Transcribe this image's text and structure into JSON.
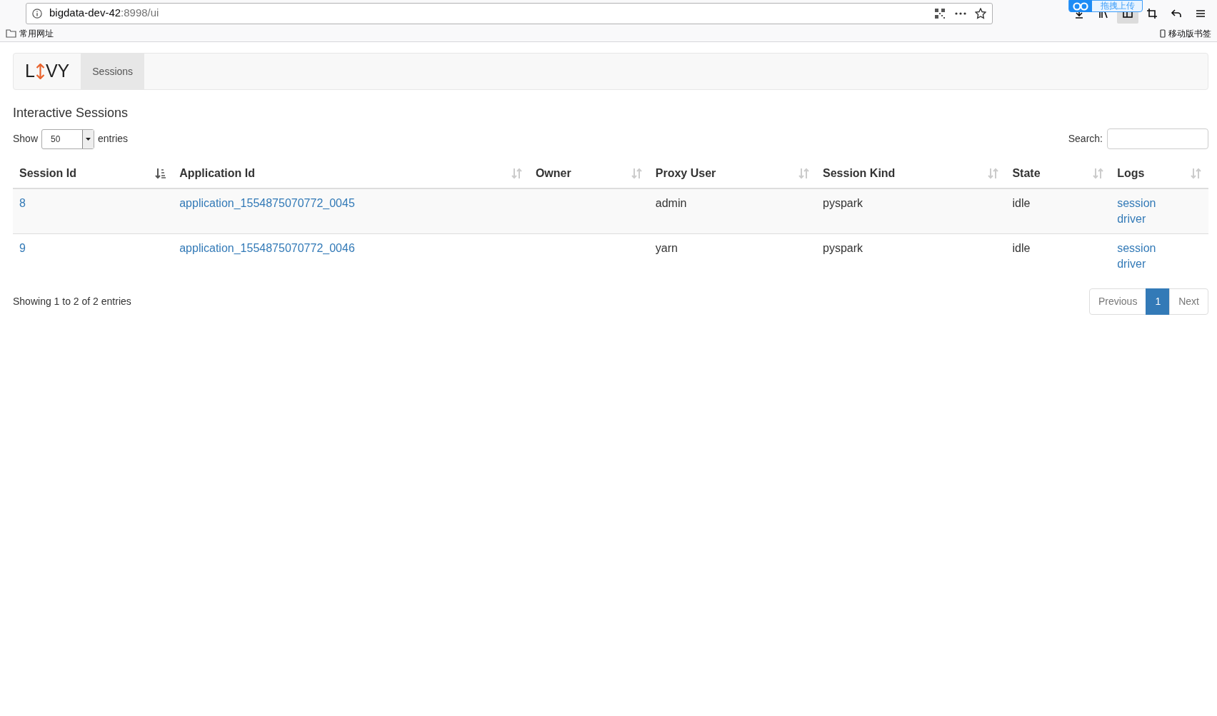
{
  "browser": {
    "url": {
      "host": "bigdata-dev-42",
      "path": ":8998/ui"
    },
    "upload_button": "拖拽上传",
    "toolbar": [
      {
        "kind": "download",
        "selected": false
      },
      {
        "kind": "library",
        "selected": false
      },
      {
        "kind": "sidebar",
        "selected": true
      },
      {
        "kind": "crop",
        "selected": false
      },
      {
        "kind": "undo",
        "selected": false
      },
      {
        "kind": "menu",
        "selected": false
      }
    ],
    "bookmarks": {
      "left": "常用网址",
      "right": "移动版书签"
    }
  },
  "navbar": {
    "brand": [
      "L",
      "VY"
    ],
    "items": [
      {
        "label": "Sessions",
        "selected": true
      }
    ]
  },
  "title": "Interactive Sessions",
  "length": {
    "before": "Show",
    "value": "50",
    "after": "entries"
  },
  "search": {
    "label": "Search:"
  },
  "table": {
    "columns": [
      {
        "label": "Session Id",
        "sorted": true
      },
      {
        "label": "Application Id",
        "sorted": false
      },
      {
        "label": "Owner",
        "sorted": false
      },
      {
        "label": "Proxy User",
        "sorted": false
      },
      {
        "label": "Session Kind",
        "sorted": false
      },
      {
        "label": "State",
        "sorted": false
      },
      {
        "label": "Logs",
        "sorted": false
      }
    ],
    "rows": [
      {
        "session_id": "8",
        "application_id": "application_1554875070772_0045",
        "proxy_user": "admin",
        "session_kind": "pyspark",
        "state": "idle",
        "logs": [
          "session",
          "driver"
        ]
      },
      {
        "session_id": "9",
        "application_id": "application_1554875070772_0046",
        "proxy_user": "yarn",
        "session_kind": "pyspark",
        "state": "idle",
        "logs": [
          "session",
          "driver"
        ]
      }
    ]
  },
  "info": "Showing 1 to 2 of 2 entries",
  "pagination": [
    {
      "label": "Previous",
      "selected": false
    },
    {
      "label": "1",
      "selected": true
    },
    {
      "label": "Next",
      "selected": false
    }
  ]
}
